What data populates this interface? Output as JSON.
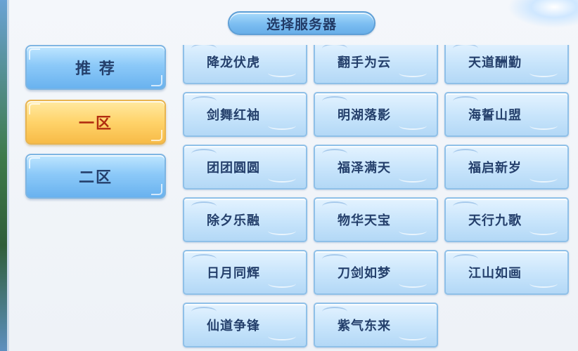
{
  "header": {
    "title": "选择服务器"
  },
  "tabs": [
    {
      "label": "推 荐",
      "selected": false
    },
    {
      "label": "一区",
      "selected": true
    },
    {
      "label": "二区",
      "selected": false
    }
  ],
  "servers": [
    "降龙伏虎",
    "翻手为云",
    "天道酬勤",
    "剑舞红袖",
    "明湖落影",
    "海誓山盟",
    "团团圆圆",
    "福泽满天",
    "福启新岁",
    "除夕乐融",
    "物华天宝",
    "天行九歌",
    "日月同辉",
    "刀剑如梦",
    "江山如画",
    "仙道争锋",
    "紫气东来"
  ],
  "colors": {
    "tab_selected_bg": "#ffd36a",
    "tab_selected_text": "#b12d10",
    "tab_normal_bg": "#8cc9f8",
    "text_primary": "#243f6b"
  }
}
